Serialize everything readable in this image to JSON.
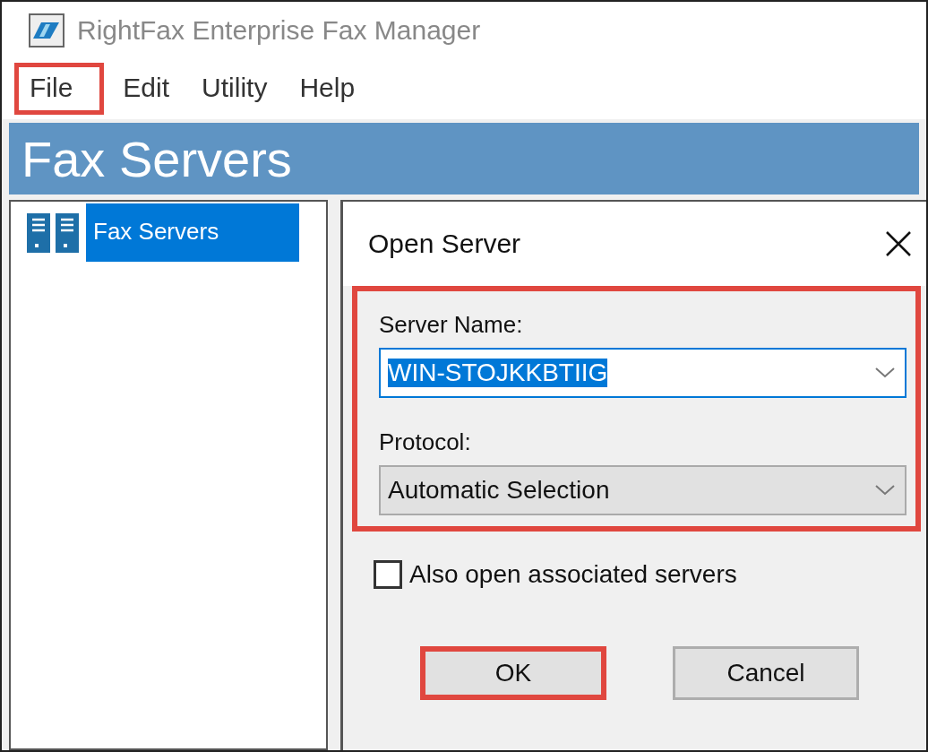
{
  "window": {
    "title": "RightFax Enterprise Fax Manager"
  },
  "menu": [
    {
      "label": "File",
      "highlighted": true
    },
    {
      "label": "Edit",
      "highlighted": false
    },
    {
      "label": "Utility",
      "highlighted": false
    },
    {
      "label": "Help",
      "highlighted": false
    }
  ],
  "header": {
    "title": "Fax Servers"
  },
  "tree": {
    "items": [
      {
        "label": "Fax Servers",
        "selected": true
      }
    ]
  },
  "dialog": {
    "title": "Open Server",
    "fields_highlighted": true,
    "fields": [
      {
        "label": "Server Name:",
        "value": "WIN-STOJKKBTIIG",
        "kind": "editable",
        "focused": true,
        "text_selected": true
      },
      {
        "label": "Protocol:",
        "value": "Automatic Selection",
        "kind": "dropdown",
        "focused": false,
        "text_selected": false
      }
    ],
    "checkbox": {
      "label": "Also open associated servers",
      "checked": false
    },
    "buttons": [
      {
        "label": "OK",
        "highlighted": true
      },
      {
        "label": "Cancel",
        "highlighted": false
      }
    ]
  }
}
